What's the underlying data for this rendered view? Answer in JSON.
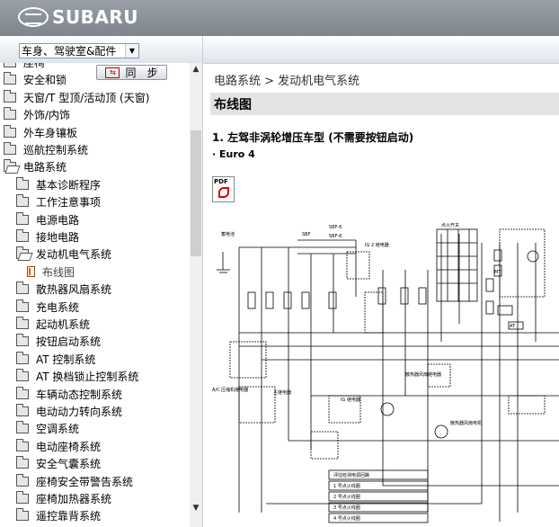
{
  "brand": "SUBARU",
  "toolbar": {
    "category_select": "车身、驾驶室&配件"
  },
  "sidebar": {
    "sync_button": "同　步",
    "items": [
      {
        "label": "座椅",
        "level": 0
      },
      {
        "label": "安全和锁",
        "level": 0
      },
      {
        "label": "天窗/T 型顶/活动顶 (天窗)",
        "level": 0
      },
      {
        "label": "外饰/内饰",
        "level": 0
      },
      {
        "label": "外车身镶板",
        "level": 0
      },
      {
        "label": "巡航控制系统",
        "level": 0
      },
      {
        "label": "电路系统",
        "level": 0
      },
      {
        "label": "基本诊断程序",
        "level": 1
      },
      {
        "label": "工作注意事项",
        "level": 1
      },
      {
        "label": "电源电路",
        "level": 1
      },
      {
        "label": "接地电路",
        "level": 1
      },
      {
        "label": "发动机电气系统",
        "level": 1
      },
      {
        "label": "布线图",
        "level": 2
      },
      {
        "label": "散热器风扇系统",
        "level": 1
      },
      {
        "label": "充电系统",
        "level": 1
      },
      {
        "label": "起动机系统",
        "level": 1
      },
      {
        "label": "按钮启动系统",
        "level": 1
      },
      {
        "label": "AT 控制系统",
        "level": 1
      },
      {
        "label": "AT 换档锁止控制系统",
        "level": 1
      },
      {
        "label": "车辆动态控制系统",
        "level": 1
      },
      {
        "label": "电动动力转向系统",
        "level": 1
      },
      {
        "label": "空调系统",
        "level": 1
      },
      {
        "label": "电动座椅系统",
        "level": 1
      },
      {
        "label": "安全气囊系统",
        "level": 1
      },
      {
        "label": "座椅安全带警告系统",
        "level": 1
      },
      {
        "label": "座椅加热器系统",
        "level": 1
      },
      {
        "label": "遥控靠背系统",
        "level": 1
      }
    ]
  },
  "main": {
    "breadcrumb": "电路系统 > 发动机电气系统",
    "title": "布线图",
    "section_heading": "1.  左驾非涡轮增压车型 (不需要按钮启动)",
    "variant": "· Euro 4",
    "pdf_label": "PDF"
  },
  "diagram": {
    "labels": {
      "sbf_top": "SBF-6",
      "sbf_mid": "SBF-6",
      "sbf_left": "SBF",
      "ig2_relay": "IG 2 继电器",
      "battery": "蓄电池",
      "ignition_switch": "点火开关",
      "ig_relay": "IG 继电器",
      "main_relay": "主继电器",
      "ac_relay": "A/C 压缩机继电器",
      "fan_relay": "散热器风扇继电器",
      "fan_motor": "散热器风扇电机",
      "at_box": "AT",
      "mt_box": "MT",
      "wiring_list": [
        "评估检测电源回路",
        "1 号点火线圈",
        "2 号点火线圈",
        "3 号点火线圈",
        "4 号点火线圈"
      ]
    }
  }
}
